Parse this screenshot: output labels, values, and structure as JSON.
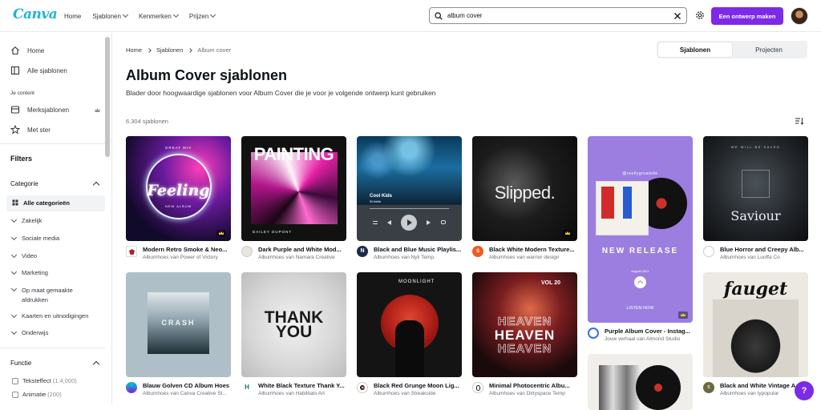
{
  "header": {
    "logo": "Canva",
    "nav": [
      {
        "label": "Home",
        "has_menu": false
      },
      {
        "label": "Sjablonen",
        "has_menu": true
      },
      {
        "label": "Kenmerken",
        "has_menu": true
      },
      {
        "label": "Prijzen",
        "has_menu": true
      }
    ],
    "search_value": "album cover",
    "cta_label": "Een ontwerp maken",
    "accent": "#7d2ae8"
  },
  "sidebar": {
    "items": [
      {
        "label": "Home",
        "icon": "home-icon"
      },
      {
        "label": "Alle sjablonen",
        "icon": "templates-icon"
      }
    ],
    "content_section": "Je content",
    "content_items": [
      {
        "label": "Merksjablonen",
        "icon": "brand-icon"
      },
      {
        "label": "Met ster",
        "icon": "star-icon"
      }
    ],
    "filters_title": "Filters",
    "category_title": "Categorie",
    "categories": [
      "Alle categorieën",
      "Zakelijk",
      "Sociale media",
      "Video",
      "Marketing",
      "Op maat gemaakte afdrukken",
      "Kaarten en uitnodigingen",
      "Onderwijs"
    ],
    "function_title": "Functie",
    "functions": [
      {
        "label": "Teksteffect",
        "count": "(1.4,000)"
      },
      {
        "label": "Animatie",
        "count": "(200)"
      }
    ]
  },
  "main": {
    "breadcrumb": [
      "Home",
      "Sjablonen",
      "Album cover"
    ],
    "tabs": [
      "Sjablonen",
      "Projecten"
    ],
    "title": "Album Cover sjablonen",
    "subtitle": "Blader door hoogwaardige sjablonen voor Album Cover die je voor je volgende ontwerp kunt gebruiken",
    "count": "6.304 sjablonen"
  },
  "cards": [
    {
      "title": "Modern Retro Smoke & Neo...",
      "author": "Albumhoes van Power of Victory",
      "thumb_text": "Feeling",
      "small_top": "GREAT MIX",
      "small_bottom": "NEW ALBUM"
    },
    {
      "title": "Dark Purple and White Mod...",
      "author": "Albumhoes van Namara Creative",
      "thumb_text": "PAINTING",
      "small_bottom": "DAILEY DUPONT"
    },
    {
      "title": "Black and Blue Music Playlis...",
      "author": "Albumhoes van Nyli Temp.",
      "thumb_text": "Cool Kids",
      "small_bottom": "Sit fidelis"
    },
    {
      "title": "Black White Modern Texture...",
      "author": "Albumhoes van warrior design",
      "thumb_text": "Slipped."
    },
    {
      "title": "Purple Album Cover - Instag...",
      "author": "Jouw verhaal van Almond Studio",
      "thumb_text": "NEW RELEASE",
      "small_top": "@reallygreatsite",
      "small_bottom": "August 2021",
      "cta": "LISTEN NOW"
    },
    {
      "title": "Blue Horror and Creepy Alb...",
      "author": "Albumhoes van Luoffa Co",
      "thumb_text": "Saviour",
      "small_top": "WE WILL BE SAVED"
    },
    {
      "title": "Blauw Golven CD Album Hoes",
      "author": "Albumhoes van Canva Creative St...",
      "thumb_text": "CRASH"
    },
    {
      "title": "White Black Texture Thank Y...",
      "author": "Albumhoes van Habilitats Art",
      "thumb_text": "THANK YOU"
    },
    {
      "title": "Black Red Grunge Moon Lig...",
      "author": "Albumhoes van Streakside",
      "thumb_text": "MOONLIGHT"
    },
    {
      "title": "Minimal Photocentric Albu...",
      "author": "Albumhoes van Dirtyspace Temp",
      "thumb_text": "HEAVEN",
      "small_top": "VOL 20"
    },
    {
      "title": "Black and White Vintage A...",
      "author": "Albumhoes van typopular",
      "thumb_text": "fauget"
    }
  ],
  "help_label": "?"
}
